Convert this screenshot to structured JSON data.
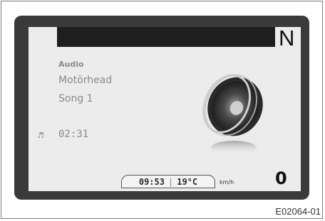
{
  "display": {
    "gear": "N",
    "source_label": "Audio",
    "artist": "Motörhead",
    "song": "Song 1",
    "elapsed_time": "02:31",
    "clock": "09:53",
    "separator": "|",
    "temperature": "19°C",
    "speed_unit": "km/h",
    "speed": "0"
  },
  "icons": {
    "track_icon": "music-note-icon",
    "artwork": "speaker-icon"
  },
  "figure_id": "E02064-01",
  "colors": {
    "bezel": "#3a3a3a",
    "screen": "#ececec",
    "topbar": "#1e1e1e",
    "muted_text": "#8a8a8a"
  }
}
